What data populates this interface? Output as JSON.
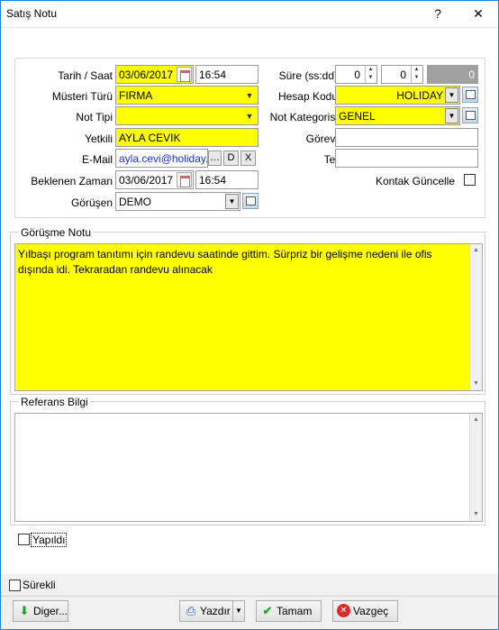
{
  "window": {
    "title": "Satış Notu",
    "help": "?",
    "close": "✕"
  },
  "form": {
    "tarih_saat": {
      "label": "Tarih / Saat",
      "date": "03/06/2017",
      "time": "16:54"
    },
    "sure": {
      "label": "Süre (ss:dd)",
      "hours": "0",
      "minutes": "0",
      "total": "0"
    },
    "musteri_turu": {
      "label": "Müsteri Türü",
      "value": "FIRMA"
    },
    "hesap_kodu": {
      "label": "Hesap Kodu",
      "value": "HOLIDAY"
    },
    "not_tipi": {
      "label": "Not Tipi",
      "value": ""
    },
    "not_kategorisi": {
      "label": "Not Kategorisi",
      "value": "GENEL"
    },
    "yetkili": {
      "label": "Yetkili",
      "value": "AYLA CEVIK"
    },
    "gorevi": {
      "label": "Görevi",
      "value": ""
    },
    "email": {
      "label": "E-Mail",
      "value": "ayla.cevi@holiday.",
      "btn_more": "…",
      "btn_d": "D",
      "btn_x": "X"
    },
    "tel": {
      "label": "Tel",
      "value": ""
    },
    "beklenen_zaman": {
      "label": "Beklenen Zaman",
      "date": "03/06/2017",
      "time": "16:54"
    },
    "kontak_guncelle": {
      "label": "Kontak Güncelle",
      "checked": false
    },
    "gorusen": {
      "label": "Görüşen",
      "value": "DEMO"
    }
  },
  "gorusme_notu": {
    "title": "Görüşme Notu",
    "text": "Yılbaşı program tanıtımı için randevu saatinde gittim. Sürpriz bir gelişme nedeni ile ofis dışında idi. Tekraradan randevu alınacak"
  },
  "referans_bilgi": {
    "title": "Referans Bilgi",
    "text": ""
  },
  "yapildi": {
    "label": "Yapıldı",
    "checked": false
  },
  "surekli": {
    "label": "Sürekli",
    "checked": false
  },
  "buttons": {
    "diger": "Diger...",
    "yazdir": "Yazdır",
    "tamam": "Tamam",
    "vazgec": "Vazgeç"
  },
  "colors": {
    "yellow": "#ffff00",
    "accent": "#1883d7"
  }
}
